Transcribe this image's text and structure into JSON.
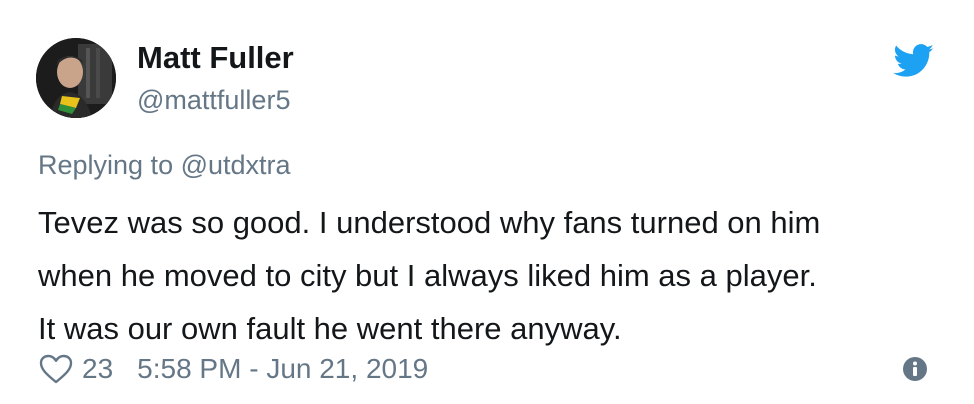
{
  "tweet": {
    "author": {
      "display_name": "Matt Fuller",
      "handle": "@mattfuller5",
      "avatar_icon": "profile-photo"
    },
    "reply": {
      "prefix": "Replying to",
      "mention": "@utdxtra"
    },
    "text_lines": [
      "Tevez was so good. I understood why fans turned on him",
      "when he moved to city but I always liked him as a player.",
      "It was our own fault he went there anyway."
    ],
    "likes": "23",
    "timestamp": "5:58 PM - Jun 21, 2019",
    "icons": {
      "brand": "twitter-bird-icon",
      "like": "heart-icon",
      "info": "info-icon"
    },
    "colors": {
      "brand": "#1da1f2",
      "text": "#14171a",
      "muted": "#657786"
    }
  }
}
